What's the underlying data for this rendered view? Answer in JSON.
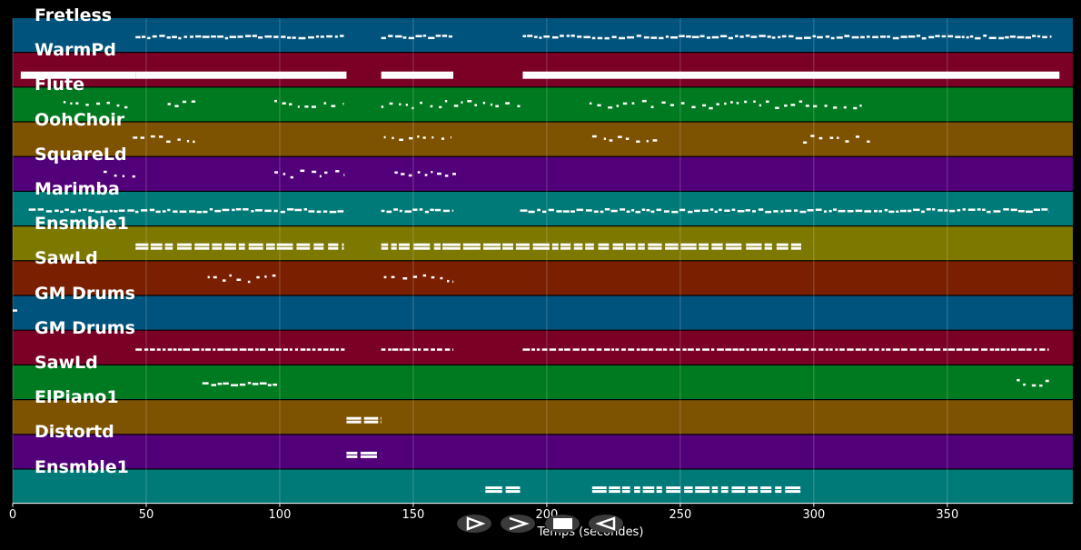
{
  "axis": {
    "xlabel": "Temps (secondes)",
    "xlim": [
      0,
      397
    ],
    "ticks": [
      "0",
      "50",
      "100",
      "150",
      "200",
      "250",
      "300",
      "350"
    ],
    "tick_values": [
      0,
      50,
      100,
      150,
      200,
      250,
      300,
      350
    ]
  },
  "colors": {
    "background": "#000000",
    "notes": "#ffffff",
    "track_colors": [
      "#00537d",
      "#7a0026",
      "#007a20",
      "#7d5200",
      "#52007a",
      "#007a78",
      "#7d7800",
      "#7a2000"
    ]
  },
  "tracks": [
    {
      "name": "Fretless",
      "color": "#00537d"
    },
    {
      "name": "WarmPd",
      "color": "#7a0026"
    },
    {
      "name": "Flute",
      "color": "#007a20"
    },
    {
      "name": "OohChoir",
      "color": "#7d5200"
    },
    {
      "name": "SquareLd",
      "color": "#52007a"
    },
    {
      "name": "Marimba",
      "color": "#007a78"
    },
    {
      "name": "Ensmble1",
      "color": "#7d7800"
    },
    {
      "name": "SawLd",
      "color": "#7a2000"
    },
    {
      "name": "GM Drums",
      "color": "#00537d"
    },
    {
      "name": "GM Drums",
      "color": "#7a0026"
    },
    {
      "name": "SawLd",
      "color": "#007a20"
    },
    {
      "name": "ElPiano1",
      "color": "#7d5200"
    },
    {
      "name": "Distortd",
      "color": "#52007a"
    },
    {
      "name": "Ensmble1",
      "color": "#007a78"
    }
  ],
  "note_regions": [
    {
      "track": 0,
      "start": 46,
      "end": 124,
      "style": "squiggle"
    },
    {
      "track": 0,
      "start": 138,
      "end": 165,
      "style": "squiggle"
    },
    {
      "track": 0,
      "start": 191,
      "end": 389,
      "style": "squiggle"
    },
    {
      "track": 1,
      "start": 3,
      "end": 46,
      "style": "bar"
    },
    {
      "track": 1,
      "start": 46,
      "end": 125,
      "style": "bar"
    },
    {
      "track": 1,
      "start": 138,
      "end": 165,
      "style": "bar"
    },
    {
      "track": 1,
      "start": 191,
      "end": 392,
      "style": "bar"
    },
    {
      "track": 2,
      "start": 19,
      "end": 44,
      "style": "sparse"
    },
    {
      "track": 2,
      "start": 58,
      "end": 70,
      "style": "sparse"
    },
    {
      "track": 2,
      "start": 98,
      "end": 124,
      "style": "sparse"
    },
    {
      "track": 2,
      "start": 138,
      "end": 190,
      "style": "sparse"
    },
    {
      "track": 2,
      "start": 216,
      "end": 320,
      "style": "sparse"
    },
    {
      "track": 3,
      "start": 45,
      "end": 70,
      "style": "sparse"
    },
    {
      "track": 3,
      "start": 139,
      "end": 164,
      "style": "sparse"
    },
    {
      "track": 3,
      "start": 217,
      "end": 243,
      "style": "sparse"
    },
    {
      "track": 3,
      "start": 296,
      "end": 321,
      "style": "sparse"
    },
    {
      "track": 4,
      "start": 34,
      "end": 46,
      "style": "sparse"
    },
    {
      "track": 4,
      "start": 98,
      "end": 124,
      "style": "sparse"
    },
    {
      "track": 4,
      "start": 143,
      "end": 166,
      "style": "sparse"
    },
    {
      "track": 5,
      "start": 6,
      "end": 124,
      "style": "squiggle"
    },
    {
      "track": 5,
      "start": 138,
      "end": 165,
      "style": "squiggle"
    },
    {
      "track": 5,
      "start": 190,
      "end": 388,
      "style": "squiggle"
    },
    {
      "track": 6,
      "start": 46,
      "end": 124,
      "style": "chord"
    },
    {
      "track": 6,
      "start": 138,
      "end": 296,
      "style": "chord"
    },
    {
      "track": 7,
      "start": 73,
      "end": 99,
      "style": "sparse"
    },
    {
      "track": 7,
      "start": 139,
      "end": 165,
      "style": "sparse"
    },
    {
      "track": 8,
      "start": 0,
      "end": 2,
      "style": "sparse"
    },
    {
      "track": 9,
      "start": 46,
      "end": 125,
      "style": "dense"
    },
    {
      "track": 9,
      "start": 138,
      "end": 165,
      "style": "dense"
    },
    {
      "track": 9,
      "start": 191,
      "end": 388,
      "style": "dense"
    },
    {
      "track": 10,
      "start": 71,
      "end": 99,
      "style": "squiggle"
    },
    {
      "track": 10,
      "start": 376,
      "end": 389,
      "style": "sparse"
    },
    {
      "track": 11,
      "start": 125,
      "end": 138,
      "style": "chord"
    },
    {
      "track": 12,
      "start": 125,
      "end": 138,
      "style": "chord"
    },
    {
      "track": 13,
      "start": 177,
      "end": 190,
      "style": "chord"
    },
    {
      "track": 13,
      "start": 217,
      "end": 295,
      "style": "chord"
    }
  ],
  "transport": [
    {
      "id": "play",
      "icon": "play-icon"
    },
    {
      "id": "forward",
      "icon": "forward-icon"
    },
    {
      "id": "stop",
      "icon": "stop-icon"
    },
    {
      "id": "back",
      "icon": "back-icon"
    }
  ]
}
